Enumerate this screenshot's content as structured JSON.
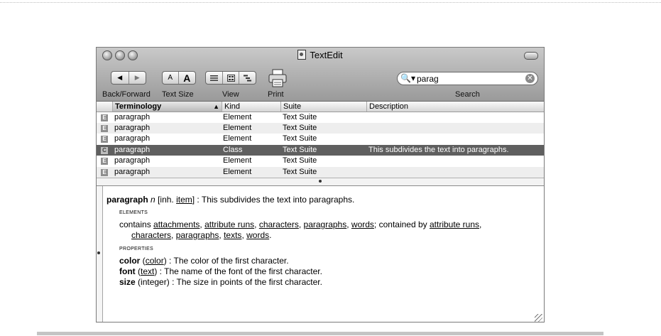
{
  "window": {
    "title": "TextEdit",
    "colors": {
      "toolbar": "#b0b0b0",
      "selected_row": "#5f5f5f",
      "alt_row": "#eeeeee"
    }
  },
  "toolbar": {
    "back_forward_label": "Back/Forward",
    "text_size_label": "Text Size",
    "view_label": "View",
    "print_label": "Print",
    "search_label": "Search",
    "back_glyph": "◀",
    "forward_glyph": "▶",
    "text_small": "A",
    "text_large": "A",
    "search_value": "parag",
    "search_icon_glyph": "🔍▾",
    "clear_glyph": "✕"
  },
  "table": {
    "headers": {
      "terminology": "Terminology",
      "kind": "Kind",
      "suite": "Suite",
      "description": "Description"
    },
    "sort_arrow": "▲",
    "rows": [
      {
        "badge": "E",
        "term": "paragraph",
        "kind": "Element",
        "suite": "Text Suite",
        "description": ""
      },
      {
        "badge": "E",
        "term": "paragraph",
        "kind": "Element",
        "suite": "Text Suite",
        "description": ""
      },
      {
        "badge": "E",
        "term": "paragraph",
        "kind": "Element",
        "suite": "Text Suite",
        "description": ""
      },
      {
        "badge": "C",
        "term": "paragraph",
        "kind": "Class",
        "suite": "Text Suite",
        "description": "This subdivides the text into paragraphs."
      },
      {
        "badge": "E",
        "term": "paragraph",
        "kind": "Element",
        "suite": "Text Suite",
        "description": ""
      },
      {
        "badge": "E",
        "term": "paragraph",
        "kind": "Element",
        "suite": "Text Suite",
        "description": ""
      }
    ]
  },
  "detail": {
    "term": "paragraph",
    "part_of_speech": "n",
    "inh_prefix": "[inh.",
    "inh_link": "item",
    "inh_suffix": "] : This subdivides the text into paragraphs.",
    "elements_heading": "ELEMENTS",
    "contains_word": "contains",
    "contains_links": [
      "attachments",
      "attribute runs",
      "characters",
      "paragraphs",
      "words"
    ],
    "contained_by_text": "; contained by",
    "contained_by_links": [
      "attribute runs",
      "characters",
      "paragraphs",
      "texts",
      "words"
    ],
    "properties_heading": "PROPERTIES",
    "properties": [
      {
        "name": "color",
        "type": "color",
        "type_is_link": true,
        "desc": " : The color of the first character."
      },
      {
        "name": "font",
        "type": "text",
        "type_is_link": true,
        "desc": " : The name of the font of the first character."
      },
      {
        "name": "size",
        "type": "integer",
        "type_is_link": false,
        "desc": " : The size in points of the first character."
      }
    ]
  }
}
